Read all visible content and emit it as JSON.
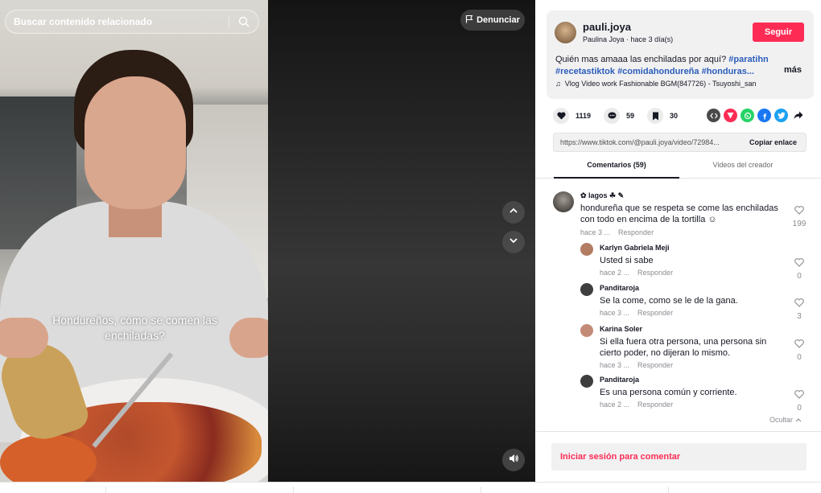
{
  "search": {
    "placeholder": "Buscar contenido relacionado"
  },
  "video": {
    "overlay_text": "Hondureños, cómo se comen las enchiladas?",
    "report_label": "Denunciar"
  },
  "creator": {
    "username": "pauli.joya",
    "display_name": "Paulina Joya",
    "separator": " · ",
    "posted": "hace 3 día(s)",
    "follow_label": "Seguir",
    "description_text": "Quién mas amaaa las enchiladas por aquí? ",
    "hashtags": [
      "#paratihn",
      "#recetastiktok",
      "#comidahondureña",
      "#honduras..."
    ],
    "more_label": "más",
    "music": "Vlog Video work Fashionable BGM(847726) - Tsuyoshi_san"
  },
  "stats": {
    "likes": "1119",
    "comments": "59",
    "saves": "30"
  },
  "share_icons": [
    {
      "name": "embed-icon",
      "color": "#4a4a4a",
      "glyph": "‹›"
    },
    {
      "name": "send-to-friends-icon",
      "color": "#fe2c55",
      "glyph": "▼"
    },
    {
      "name": "whatsapp-icon",
      "color": "#25d366",
      "glyph": "✆"
    },
    {
      "name": "facebook-icon",
      "color": "#1877f2",
      "glyph": "f"
    },
    {
      "name": "twitter-icon",
      "color": "#1da1f2",
      "glyph": "t"
    },
    {
      "name": "share-arrow-icon",
      "color": "#ffffff",
      "glyph": "➦"
    }
  ],
  "link": {
    "url": "https://www.tiktok.com/@pauli.joya/video/72984...",
    "copy_label": "Copiar enlace"
  },
  "tabs": {
    "comments": "Comentarios (59)",
    "creator_videos": "Videos del creador"
  },
  "comments": [
    {
      "name": "✿ lagos ☘ ✎",
      "text": "hondureña que se respeta se come las enchiladas con todo en encima de la tortilla ☺",
      "time": "hace 3 ...",
      "reply_label": "Responder",
      "likes": "199"
    },
    {
      "name": "Karlyn Gabriela Meji",
      "text": "Usted si sabe",
      "time": "hace 2 ...",
      "reply_label": "Responder",
      "likes": "0"
    },
    {
      "name": "Panditaroja",
      "text": "Se la come, como se le de la gana.",
      "time": "hace 3 ...",
      "reply_label": "Responder",
      "likes": "3"
    },
    {
      "name": "Karina Soler",
      "text": "Si ella fuera otra persona, una persona sin cierto poder, no dijeran lo mismo.",
      "time": "hace 3 ...",
      "reply_label": "Responder",
      "likes": "0"
    },
    {
      "name": "Panditaroja",
      "text": "Es una persona común y corriente.",
      "time": "hace 2 ...",
      "reply_label": "Responder",
      "likes": "0"
    }
  ],
  "hide_label": "Ocultar",
  "login_label": "Iniciar sesión para comentar"
}
